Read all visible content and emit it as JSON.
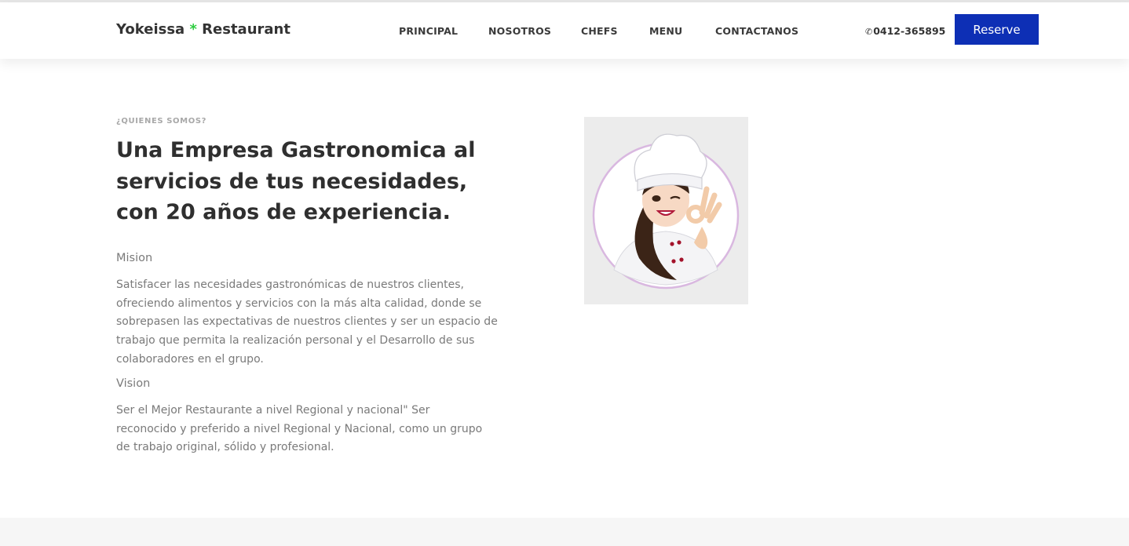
{
  "brand": {
    "name_start": "Yokeissa ",
    "star": "*",
    "name_end": " Restaurant"
  },
  "nav": {
    "items": [
      {
        "label": "PRINCIPAL"
      },
      {
        "label": "NOSOTROS"
      },
      {
        "label": "CHEFS"
      },
      {
        "label": "MENU"
      },
      {
        "label": "CONTACTANOS"
      }
    ],
    "phone_icon": "phone-icon",
    "phone": "0412-365895",
    "reserve_label": "Reserve"
  },
  "about": {
    "eyebrow": "¿QUIENES SOMOS?",
    "headline": "Una Empresa Gastronomica al servicios de tus necesidades, con 20 años de experiencia.",
    "mision_title": "Mision",
    "mision_text": "Satisfacer las necesidades gastronómicas de nuestros clientes, ofreciendo alimentos y servicios con la más alta calidad, donde se sobrepasen las expectativas de nuestros clientes y ser un espacio de trabajo que permita la realización personal y el Desarrollo de sus colaboradores en el grupo.",
    "vision_title": "Vision",
    "vision_text": "Ser el Mejor Restaurante a nivel Regional y nacional\" Ser reconocido y preferido a nivel Regional y Nacional, como un grupo de trabajo original, sólido y profesional.",
    "image": "chef-illustration"
  },
  "colors": {
    "accent_button": "#0d2fb5",
    "brand_star": "#2ecc40",
    "heading_text": "#2f2f2f",
    "body_text": "#7a7a7a"
  }
}
